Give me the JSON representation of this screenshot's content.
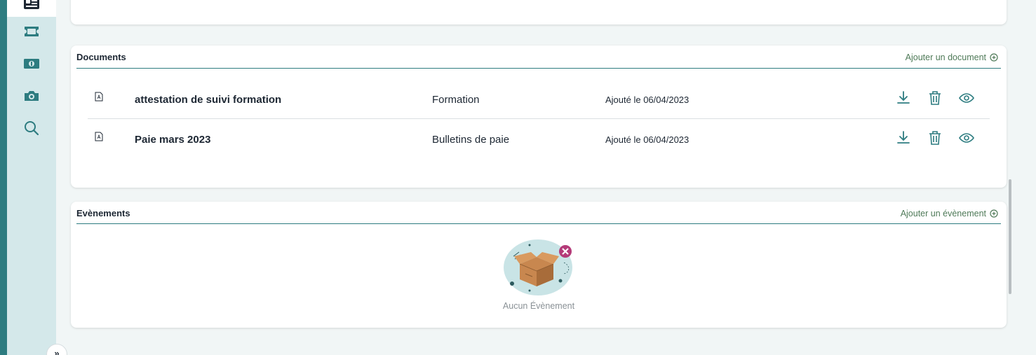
{
  "sidebar": {
    "items": [
      {
        "icon": "id-card-icon"
      },
      {
        "icon": "ticket-icon"
      },
      {
        "icon": "banknote-icon"
      },
      {
        "icon": "camera-icon"
      },
      {
        "icon": "search-icon"
      }
    ],
    "collapse_label": "»"
  },
  "documents": {
    "title": "Documents",
    "add_label": "Ajouter un document",
    "rows": [
      {
        "name": "attestation de suivi formation",
        "category": "Formation",
        "date": "Ajouté le 06/04/2023"
      },
      {
        "name": "Paie mars 2023",
        "category": "Bulletins de paie",
        "date": "Ajouté le 06/04/2023"
      }
    ]
  },
  "events": {
    "title": "Evènements",
    "add_label": "Ajouter un évènement",
    "empty_label": "Aucun Évènement"
  },
  "colors": {
    "accent": "#2d7c80",
    "link": "#4f7a58",
    "sidebar_bg": "#d4e8ea",
    "badge": "#b43a78"
  }
}
